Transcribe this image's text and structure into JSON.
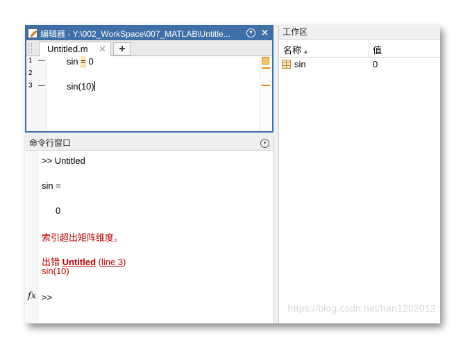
{
  "editor": {
    "title": "编辑器 - Y:\\002_WorkSpace\\007_MATLAB\\Untitle...",
    "tab_label": "Untitled.m",
    "tab_close": "✕",
    "new_tab": "+",
    "close_glyph": "✕",
    "dropdown_glyph": "▾",
    "line_numbers": [
      "1",
      "2",
      "3"
    ],
    "line_markers": [
      "—",
      "",
      "—"
    ],
    "lines": {
      "l1_pre": "sin ",
      "l1_hl": "=",
      "l1_post": " 0",
      "l3_pre": "sin(10)"
    }
  },
  "command_window": {
    "title": "命令行窗口",
    "dropdown_glyph": "▾",
    "lines": {
      "run": ">> Untitled",
      "var": "sin =",
      "value": "0",
      "error": "索引超出矩阵维度。",
      "error_prefix": "出错 ",
      "error_file": "Untitled",
      "error_open": " (",
      "error_line": "line 3",
      "error_close": ")",
      "error_code": "sin(10)",
      "fx": "fx",
      "prompt": ">>"
    }
  },
  "workspace": {
    "title": "工作区",
    "col_name": "名称",
    "sort_glyph": "▲",
    "col_value": "值",
    "rows": [
      {
        "name": "sin",
        "value": "0",
        "icon": "matrix-grid-icon"
      }
    ]
  },
  "watermark": "https://blog.csdn.net/han1202012",
  "colors": {
    "editor_title_bg": "#3e6fa6",
    "error_text": "#c00000",
    "warning": "#e58b1a"
  }
}
